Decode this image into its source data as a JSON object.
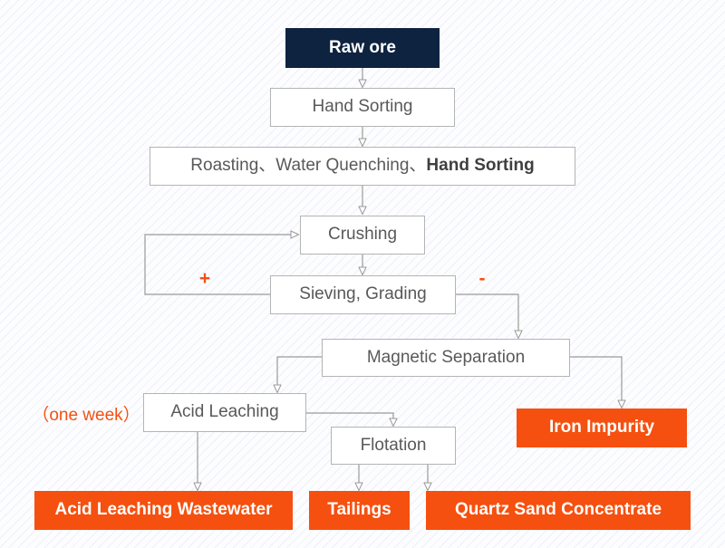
{
  "diagram": {
    "title": "Quartz Sand Ore Beneficiation Process Flowchart",
    "colors": {
      "start_fill": "#0d2340",
      "process_fill": "#ffffff",
      "process_border": "#b4b4b4",
      "output_fill": "#f5500f",
      "connector": "#9a9a9a",
      "accent": "#f5500f",
      "background": "#fdfdff",
      "process_text": "#59595b"
    },
    "nodes": [
      {
        "id": "raw_ore",
        "label": "Raw ore",
        "type": "start"
      },
      {
        "id": "hand_sorting",
        "label": "Hand Sorting",
        "type": "process"
      },
      {
        "id": "roasting",
        "label": "Roasting、Water Quenching、",
        "label_emphasis": "Hand Sorting",
        "type": "process"
      },
      {
        "id": "crushing",
        "label": "Crushing",
        "type": "process"
      },
      {
        "id": "sieving",
        "label": "Sieving, Grading",
        "type": "process"
      },
      {
        "id": "magnetic",
        "label": "Magnetic Separation",
        "type": "process"
      },
      {
        "id": "acid_leaching",
        "label": "Acid Leaching",
        "type": "process"
      },
      {
        "id": "flotation",
        "label": "Flotation",
        "type": "process"
      },
      {
        "id": "iron_impurity",
        "label": "Iron Impurity",
        "type": "output"
      },
      {
        "id": "wastewater",
        "label": "Acid Leaching Wastewater",
        "type": "output"
      },
      {
        "id": "tailings",
        "label": "Tailings",
        "type": "output"
      },
      {
        "id": "quartz_sand",
        "label": "Quartz Sand Concentrate",
        "type": "output"
      }
    ],
    "annotations": [
      {
        "id": "oversize_plus",
        "label": "+"
      },
      {
        "id": "undersize_minus",
        "label": "-"
      },
      {
        "id": "duration_note",
        "label": "（one week）"
      }
    ]
  }
}
